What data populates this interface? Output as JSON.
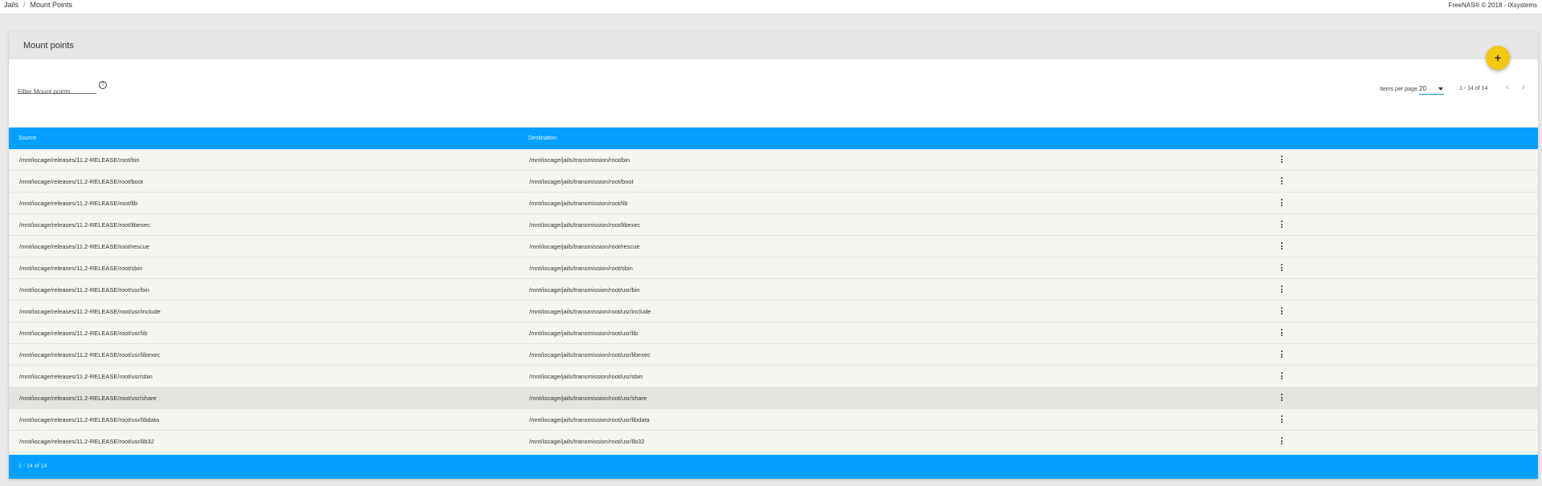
{
  "breadcrumb": [
    "Jails",
    "Mount Points"
  ],
  "copyright": "FreeNAS® © 2018 - iXsystems",
  "card": {
    "title": "Mount points"
  },
  "fab": {
    "label": "+"
  },
  "filter": {
    "placeholder": "Filter Mount points",
    "help": "?"
  },
  "pagination": {
    "items_per_page_label": "Items per page",
    "items_per_page": "20",
    "range": "1 - 14 of 14",
    "prev": "‹",
    "next": "›"
  },
  "table": {
    "columns": [
      "Source",
      "Destination"
    ],
    "rows": [
      {
        "source": "/mnt/iocage/releases/11.2-RELEASE/root/bin",
        "destination": "/mnt/iocage/jails/transmission/root/bin"
      },
      {
        "source": "/mnt/iocage/releases/11.2-RELEASE/root/boot",
        "destination": "/mnt/iocage/jails/transmission/root/boot"
      },
      {
        "source": "/mnt/iocage/releases/11.2-RELEASE/root/lib",
        "destination": "/mnt/iocage/jails/transmission/root/lib"
      },
      {
        "source": "/mnt/iocage/releases/11.2-RELEASE/root/libexec",
        "destination": "/mnt/iocage/jails/transmission/root/libexec"
      },
      {
        "source": "/mnt/iocage/releases/11.2-RELEASE/root/rescue",
        "destination": "/mnt/iocage/jails/transmission/root/rescue"
      },
      {
        "source": "/mnt/iocage/releases/11.2-RELEASE/root/sbin",
        "destination": "/mnt/iocage/jails/transmission/root/sbin"
      },
      {
        "source": "/mnt/iocage/releases/11.2-RELEASE/root/usr/bin",
        "destination": "/mnt/iocage/jails/transmission/root/usr/bin"
      },
      {
        "source": "/mnt/iocage/releases/11.2-RELEASE/root/usr/include",
        "destination": "/mnt/iocage/jails/transmission/root/usr/include"
      },
      {
        "source": "/mnt/iocage/releases/11.2-RELEASE/root/usr/lib",
        "destination": "/mnt/iocage/jails/transmission/root/usr/lib"
      },
      {
        "source": "/mnt/iocage/releases/11.2-RELEASE/root/usr/libexec",
        "destination": "/mnt/iocage/jails/transmission/root/usr/libexec"
      },
      {
        "source": "/mnt/iocage/releases/11.2-RELEASE/root/usr/sbin",
        "destination": "/mnt/iocage/jails/transmission/root/usr/sbin"
      },
      {
        "source": "/mnt/iocage/releases/11.2-RELEASE/root/usr/share",
        "destination": "/mnt/iocage/jails/transmission/root/usr/share"
      },
      {
        "source": "/mnt/iocage/releases/11.2-RELEASE/root/usr/libdata",
        "destination": "/mnt/iocage/jails/transmission/root/usr/libdata"
      },
      {
        "source": "/mnt/iocage/releases/11.2-RELEASE/root/usr/lib32",
        "destination": "/mnt/iocage/jails/transmission/root/usr/lib32"
      }
    ],
    "footer": "1 - 14 of 14"
  },
  "colors": {
    "accent": "#03a0ff",
    "fab": "#f2c811",
    "row_bg": "#f5f6f1",
    "row_highlight": "#e3e3df"
  },
  "icons": {
    "add": "plus-icon",
    "help": "help-circle-icon",
    "menu": "more-vert-icon",
    "dropdown": "caret-down-icon"
  }
}
